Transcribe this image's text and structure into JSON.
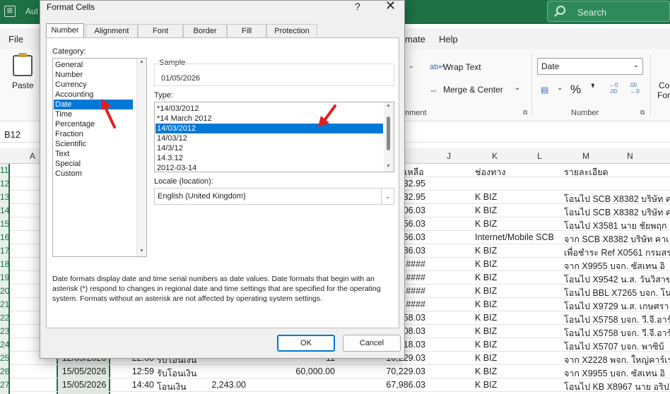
{
  "excel": {
    "title_fragment": "Aut",
    "search_label": "Search",
    "menu": {
      "file": "File",
      "mate": "mate",
      "help": "Help"
    },
    "ribbon": {
      "paste": "Paste",
      "wrap_text": "Wrap Text",
      "merge_center": "Merge & Center",
      "alignment_fragment": "nment",
      "number_format": "Date",
      "number_group": "Number",
      "co": "Co",
      "for": "For"
    },
    "name_box": "B12",
    "columns": [
      "A",
      "J",
      "K",
      "L",
      "M",
      "N"
    ],
    "rows": [
      "11",
      "12",
      "13",
      "14",
      "15",
      "16",
      "17",
      "18",
      "19",
      "20",
      "21",
      "22",
      "23",
      "24",
      "25",
      "26",
      "27"
    ],
    "header_row": {
      "i": "งเหลือ",
      "k": "ช่องทาง",
      "m": "รายละเอียด"
    },
    "balances": [
      "32.95",
      "32.95",
      "06.03",
      "56.03",
      "56.03",
      "86.03",
      "####",
      "####",
      "####",
      "####",
      "58.03",
      "08.03",
      "18.03",
      "10,229.03",
      "70,229.03",
      "67,986.03"
    ],
    "channels": [
      "K BIZ",
      "K BIZ",
      "K BIZ",
      "Internet/Mobile SCB",
      "K BIZ",
      "K BIZ",
      "K BIZ",
      "K BIZ",
      "K BIZ",
      "K BIZ",
      "K BIZ",
      "K BIZ",
      "K BIZ",
      "K BIZ",
      "K BIZ"
    ],
    "details": [
      "โอนไป SCB X8382 บริษัท ค",
      "โอนไป SCB X8382 บริษัท ค",
      "โอนไป X3581 นาย ชัยพฤก",
      "จาก SCB X8382 บริษัท คาเ",
      "เพื่อชำระ Ref X0561 กรมสร",
      "จาก X9955 บจก. ซัสเทน อิ",
      "โอนไป X9542 น.ส. วันวิสาข",
      "โอนไป BBL X7265 บจก. โน",
      "โอนไป X9729 น.ส. เกษศรา",
      "โอนไป X5758 บจก. วี.จี.อาร์",
      "โอนไป X5758 บจก. วี.จี.อาร์",
      "โอนไป X5707 บจก. พาซิบ้",
      "จาก X2228 พจก. ใหญ่คาร์เร",
      "จาก X9955 บจก. ซัสเทน อิ",
      "โอนไป KB X8967 นาย อริป เอ"
    ],
    "bottom_rows": [
      {
        "date": "12/05/2026",
        "time": "22:08",
        "desc": "รับโอนเงิน",
        "out": "",
        "in": "11",
        "bal": "10,229.03"
      },
      {
        "date": "15/05/2026",
        "time": "12:59",
        "desc": "รับโอนเงิน",
        "out": "",
        "in": "60,000.00",
        "bal": "70,229.03"
      },
      {
        "date": "15/05/2026",
        "time": "14:40",
        "desc": "โอนเงิน",
        "out": "2,243.00",
        "in": "",
        "bal": "67,986.03"
      }
    ]
  },
  "dialog": {
    "title": "Format Cells",
    "help": "?",
    "close": "✕",
    "tabs": [
      "Number",
      "Alignment",
      "Font",
      "Border",
      "Fill",
      "Protection"
    ],
    "category_label": "Category:",
    "categories": [
      "General",
      "Number",
      "Currency",
      "Accounting",
      "Date",
      "Time",
      "Percentage",
      "Fraction",
      "Scientific",
      "Text",
      "Special",
      "Custom"
    ],
    "selected_category": "Date",
    "sample_label": "Sample",
    "sample_value": "01/05/2026",
    "type_label": "Type:",
    "types": [
      "*14/03/2012",
      "*14 March 2012",
      "14/03/2012",
      "14/03/12",
      "14/3/12",
      "14.3.12",
      "2012-03-14"
    ],
    "selected_type": "14/03/2012",
    "locale_label": "Locale (location):",
    "locale_value": "English (United Kingdom)",
    "description": "Date formats display date and time serial numbers as date values.  Date formats that begin with an asterisk (*) respond to changes in regional date and time settings that are specified for the operating system. Formats without an asterisk are not affected by operating system settings.",
    "ok": "OK",
    "cancel": "Cancel"
  },
  "colors": {
    "excel_green": "#1e7145",
    "selection_blue": "#0078d7",
    "annotation_red": "#e02020"
  }
}
